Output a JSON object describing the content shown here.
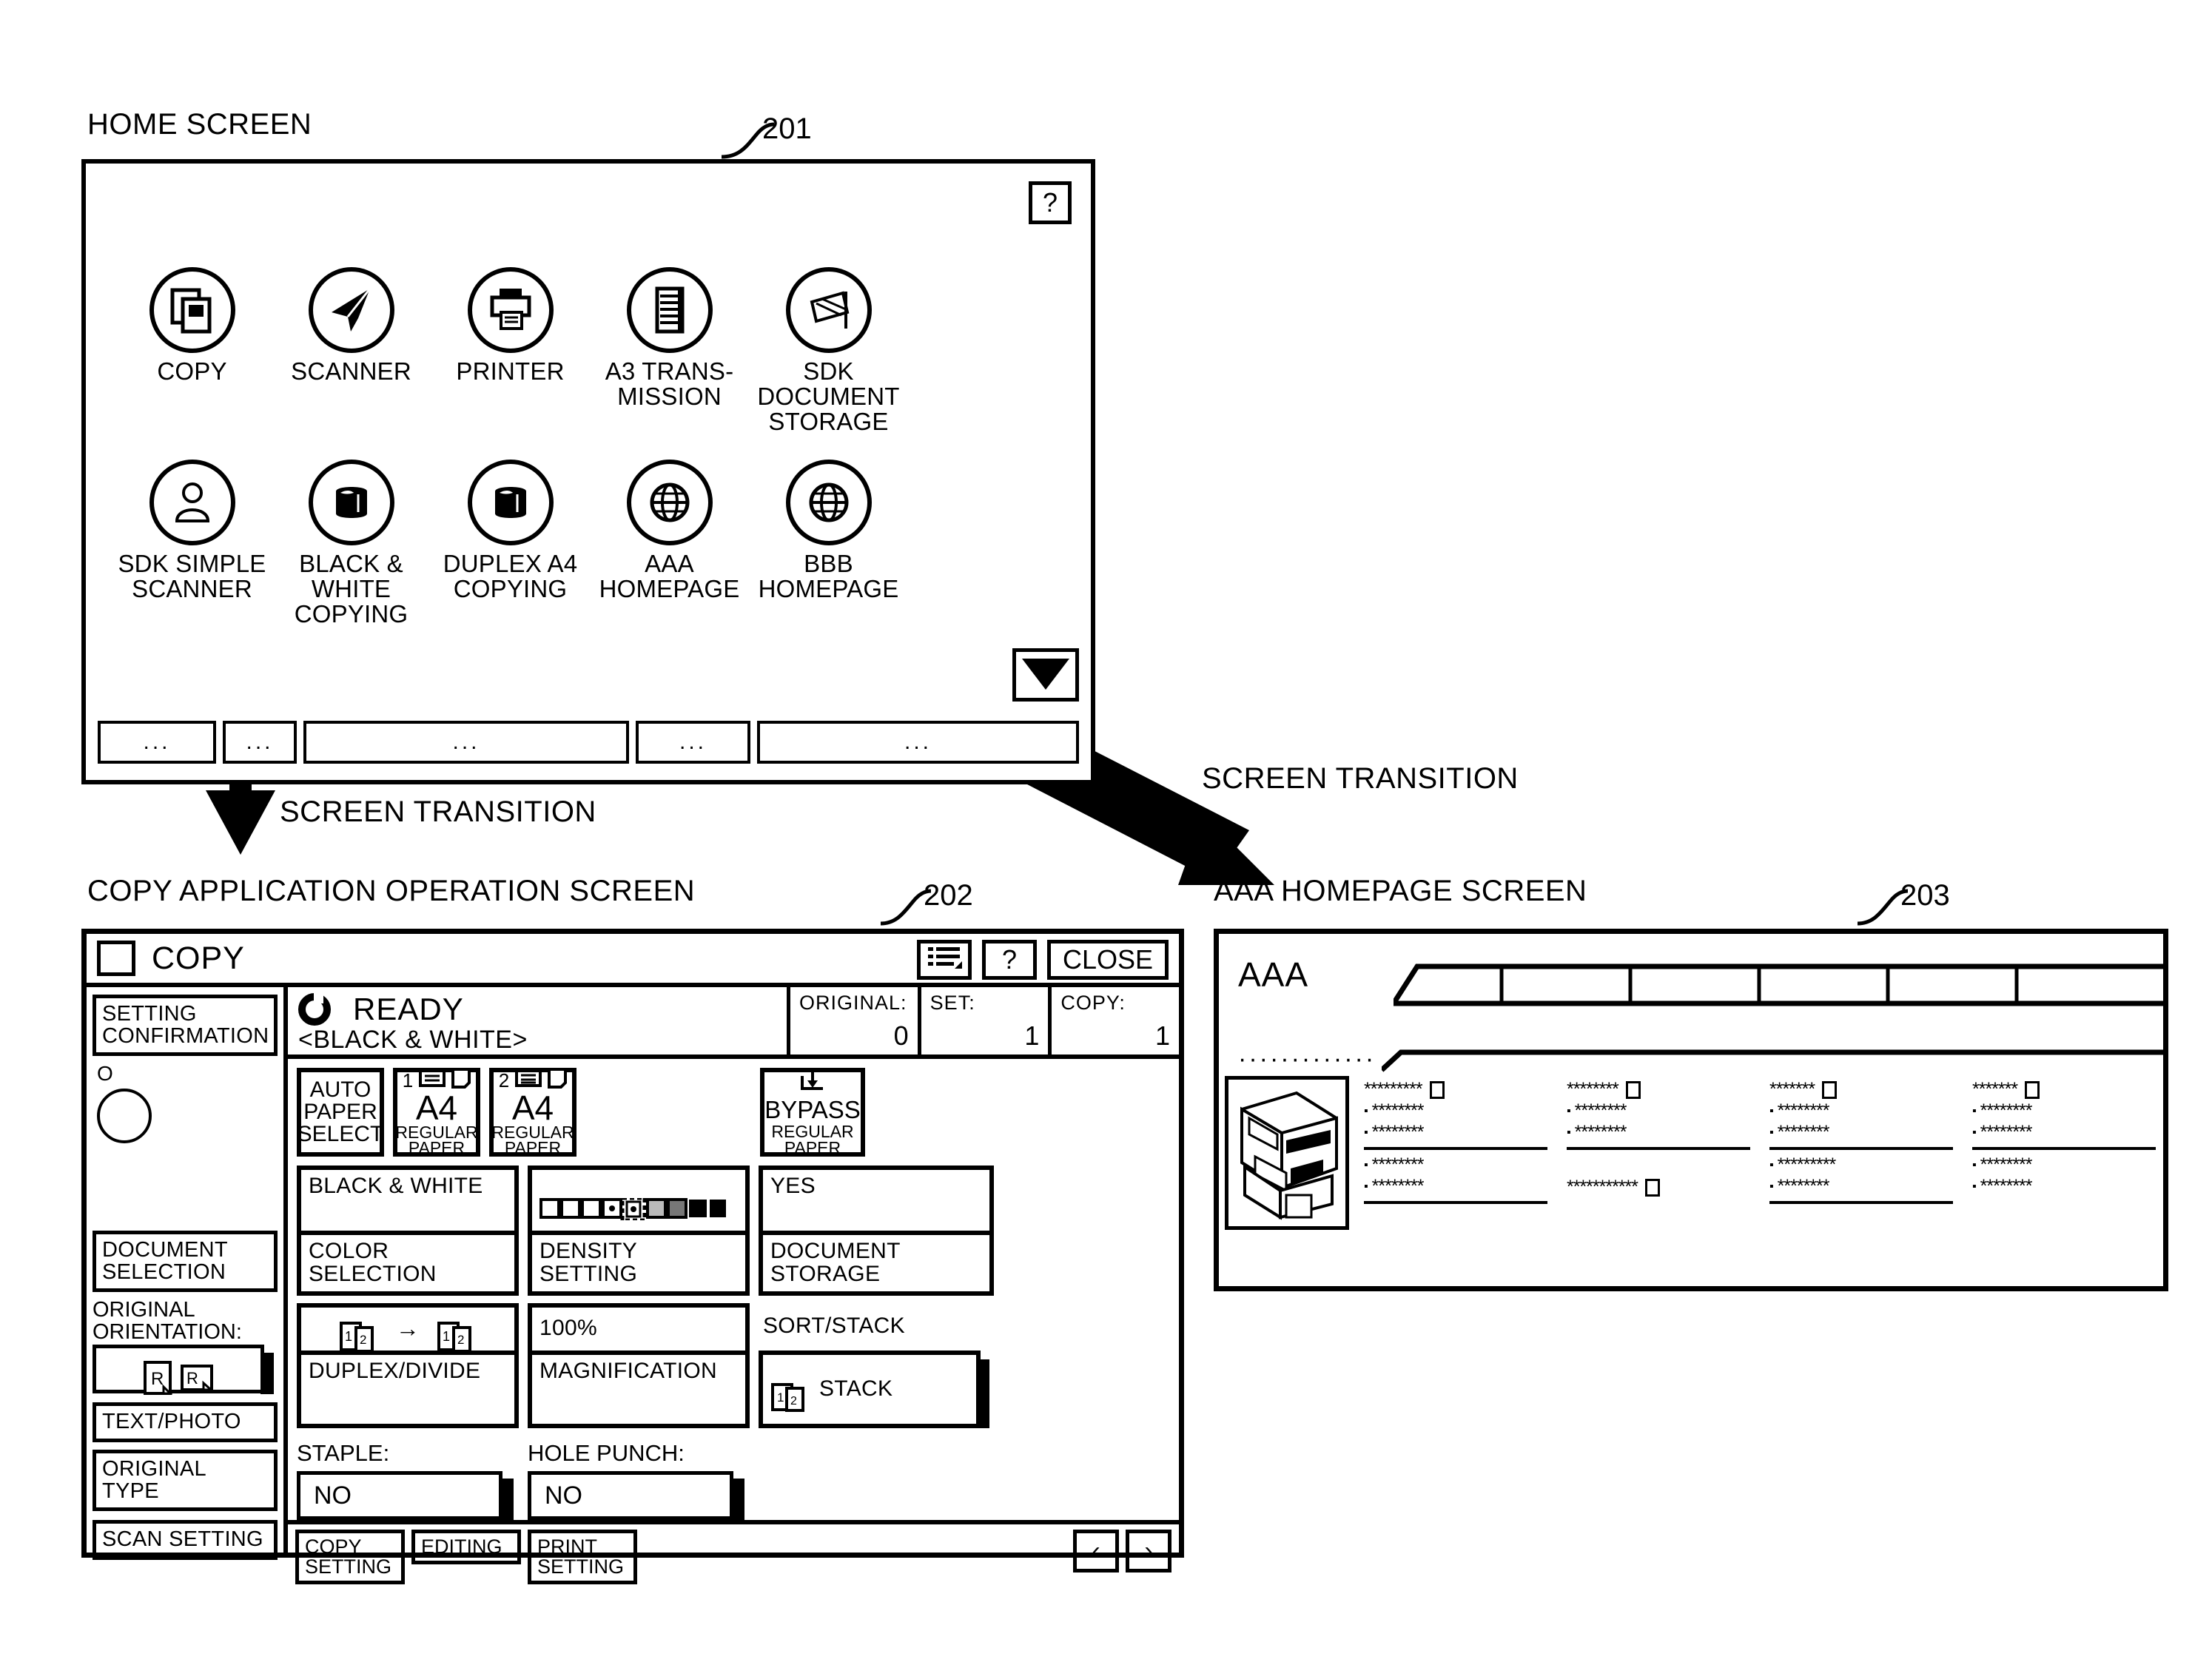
{
  "figure": {
    "home_caption": "HOME SCREEN",
    "home_ref": "201",
    "copy_caption": "COPY APPLICATION OPERATION SCREEN",
    "copy_ref": "202",
    "aaa_caption": "AAA HOMEPAGE SCREEN",
    "aaa_ref": "203",
    "transition_label_1": "SCREEN TRANSITION",
    "transition_label_2": "SCREEN TRANSITION"
  },
  "home": {
    "help_label": "?",
    "icons": [
      {
        "label": "COPY",
        "icon": "copy-icon"
      },
      {
        "label": "SCANNER",
        "icon": "send-arrow-icon"
      },
      {
        "label": "PRINTER",
        "icon": "printer-icon"
      },
      {
        "label": "A3 TRANS-\nMISSION",
        "icon": "fax-list-icon"
      },
      {
        "label": "SDK\nDOCUMENT\nSTORAGE",
        "icon": "document-stack-icon"
      },
      {
        "label": "SDK SIMPLE\nSCANNER",
        "icon": "person-icon"
      },
      {
        "label": "BLACK &\nWHITE\nCOPYING",
        "icon": "black-drum-icon"
      },
      {
        "label": "DUPLEX A4\nCOPYING",
        "icon": "black-drum-icon"
      },
      {
        "label": "AAA\nHOMEPAGE",
        "icon": "globe-icon"
      },
      {
        "label": "BBB\nHOMEPAGE",
        "icon": "globe-icon"
      }
    ],
    "scroll_down_icon": "scroll-down-triangle-icon",
    "tabs": [
      "...",
      "...",
      "...",
      "...",
      "..."
    ]
  },
  "copy": {
    "app_title": "COPY",
    "titlebar": {
      "list_icon": "list-menu-icon",
      "help_label": "?",
      "close_label": "CLOSE"
    },
    "status": {
      "ready_icon": "power-ready-icon",
      "ready_text": "READY",
      "mode_text": "<BLACK & WHITE>",
      "counters": [
        {
          "name": "ORIGINAL:",
          "value": "0"
        },
        {
          "name": "SET:",
          "value": "1"
        },
        {
          "name": "COPY:",
          "value": "1"
        }
      ]
    },
    "left_panel": {
      "setting_confirmation": "SETTING\nCONFIRMATION",
      "status_mark": "O",
      "document_selection": "DOCUMENT\nSELECTION",
      "original_orientation_label": "ORIGINAL\nORIENTATION:",
      "original_orientation_value": "R R",
      "text_photo": "TEXT/PHOTO",
      "original_type": "ORIGINAL\nTYPE",
      "scan_setting": "SCAN SETTING"
    },
    "paper": {
      "auto_select": "AUTO\nPAPER\nSELECT",
      "trays": [
        {
          "num": "1",
          "size": "A4",
          "type": "REGULAR\nPAPER"
        },
        {
          "num": "2",
          "size": "A4",
          "type": "REGULAR\nPAPER"
        }
      ],
      "bypass": {
        "name": "BYPASS",
        "type": "REGULAR\nPAPER",
        "icon": "bypass-down-arrow-icon"
      }
    },
    "options": {
      "color_value": "BLACK & WHITE",
      "color_label": "COLOR\nSELECTION",
      "density_value_icon": "density-scale-icon",
      "density_label": "DENSITY\nSETTING",
      "storage_value": "YES",
      "storage_label": "DOCUMENT\nSTORAGE",
      "duplex_value_icon": "duplex-1to2-icon",
      "duplex_label": "DUPLEX/DIVIDE",
      "magnification_value": "100%",
      "magnification_label": "MAGNIFICATION",
      "sort_label": "SORT/STACK",
      "sort_value": "STACK",
      "sort_value_icon": "stack-pages-icon"
    },
    "finishing": {
      "staple_label": "STAPLE:",
      "staple_value": "NO",
      "hole_punch_label": "HOLE PUNCH:",
      "hole_punch_value": "NO"
    },
    "bottom_tabs": [
      "COPY\nSETTING",
      "EDITING",
      "PRINT\nSETTING"
    ],
    "nav": {
      "prev": "‹",
      "next": "›"
    }
  },
  "aaa": {
    "title": "AAA",
    "dots": "·············",
    "printer_image_icon": "mfp-printer-illustration",
    "columns": [
      {
        "lines": [
          {
            "text": "*********",
            "bullet": false,
            "check": true
          },
          {
            "text": "********",
            "bullet": true,
            "check": false
          },
          {
            "text": "********",
            "bullet": true,
            "check": false
          },
          {
            "rule": true
          },
          {
            "text": "********",
            "bullet": true,
            "check": false
          },
          {
            "text": "********",
            "bullet": true,
            "check": false
          },
          {
            "rule": true
          }
        ]
      },
      {
        "lines": [
          {
            "text": "********",
            "bullet": false,
            "check": true
          },
          {
            "text": "********",
            "bullet": true,
            "check": false
          },
          {
            "text": "********",
            "bullet": true,
            "check": false
          },
          {
            "rule": true
          },
          {
            "text": "***********",
            "bullet": false,
            "check": true
          }
        ]
      },
      {
        "lines": [
          {
            "text": "*******",
            "bullet": false,
            "check": true
          },
          {
            "text": "********",
            "bullet": true,
            "check": false
          },
          {
            "text": "********",
            "bullet": true,
            "check": false
          },
          {
            "rule": true
          },
          {
            "text": "*********",
            "bullet": true,
            "check": false
          },
          {
            "text": "********",
            "bullet": true,
            "check": false
          },
          {
            "rule": true
          }
        ]
      },
      {
        "lines": [
          {
            "text": "*******",
            "bullet": false,
            "check": true
          },
          {
            "text": "********",
            "bullet": true,
            "check": false
          },
          {
            "text": "********",
            "bullet": true,
            "check": false
          },
          {
            "rule": true
          },
          {
            "text": "********",
            "bullet": true,
            "check": false
          },
          {
            "text": "********",
            "bullet": true,
            "check": false
          }
        ]
      }
    ]
  }
}
